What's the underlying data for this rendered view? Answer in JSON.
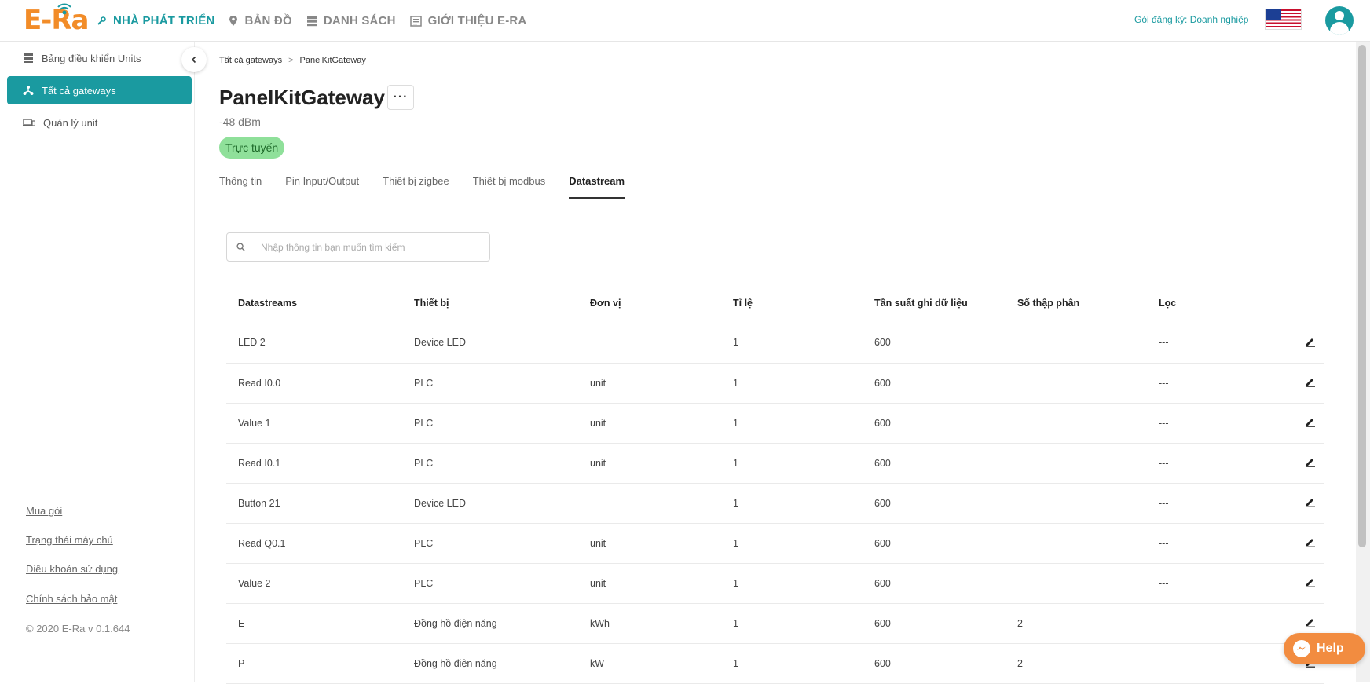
{
  "brand": {
    "logo_text": "E-Ra"
  },
  "nav": [
    {
      "label": "NHÀ PHÁT TRIỂN",
      "icon": "wrench-icon",
      "active": true
    },
    {
      "label": "BẢN ĐỒ",
      "icon": "map-pin-icon",
      "active": false
    },
    {
      "label": "DANH SÁCH",
      "icon": "list-icon",
      "active": false
    },
    {
      "label": "GIỚI THIỆU E-RA",
      "icon": "info-card-icon",
      "active": false
    }
  ],
  "header": {
    "plan_label": "Gói đăng ký: Doanh nghiệp"
  },
  "sidebar": {
    "items": [
      {
        "label": "Bảng điều khiển Units",
        "icon": "dashboard-icon"
      },
      {
        "label": "Tất cả gateways",
        "icon": "gateway-icon",
        "active": true
      },
      {
        "label": "Quản lý unit",
        "icon": "devices-icon"
      }
    ],
    "links": [
      "Mua gói",
      "Trạng thái máy chủ",
      "Điều khoản sử dụng",
      "Chính sách bảo mật"
    ],
    "copyright": "© 2020 E-Ra v 0.1.644"
  },
  "breadcrumb": {
    "parent": "Tất cả gateways",
    "sep": ">",
    "current": "PanelKitGateway"
  },
  "gateway": {
    "title": "PanelKitGateway",
    "more": "···",
    "signal": "-48 dBm",
    "status": "Trực tuyến"
  },
  "tabs": [
    "Thông tin",
    "Pin Input/Output",
    "Thiết bị zigbee",
    "Thiết bị modbus",
    "Datastream"
  ],
  "search": {
    "placeholder": "Nhập thông tin bạn muốn tìm kiếm",
    "value": ""
  },
  "table": {
    "columns": [
      "Datastreams",
      "Thiết bị",
      "Đơn vị",
      "Tỉ lệ",
      "Tần suất ghi dữ liệu",
      "Số thập phân",
      "Lọc"
    ],
    "rows": [
      [
        "LED 2",
        "Device LED",
        "",
        "1",
        "600",
        "",
        "---"
      ],
      [
        "Read I0.0",
        "PLC",
        "unit",
        "1",
        "600",
        "",
        "---"
      ],
      [
        "Value 1",
        "PLC",
        "unit",
        "1",
        "600",
        "",
        "---"
      ],
      [
        "Read I0.1",
        "PLC",
        "unit",
        "1",
        "600",
        "",
        "---"
      ],
      [
        "Button 21",
        "Device LED",
        "",
        "1",
        "600",
        "",
        "---"
      ],
      [
        "Read Q0.1",
        "PLC",
        "unit",
        "1",
        "600",
        "",
        "---"
      ],
      [
        "Value 2",
        "PLC",
        "unit",
        "1",
        "600",
        "",
        "---"
      ],
      [
        "E",
        "Đồng hồ điện năng",
        "kWh",
        "1",
        "600",
        "2",
        "---"
      ],
      [
        "P",
        "Đồng hồ điện năng",
        "kW",
        "1",
        "600",
        "2",
        "---"
      ]
    ]
  },
  "help": {
    "label": "Help"
  },
  "colors": {
    "accent": "#1a9aa0",
    "brand": "#f28c28",
    "status_bg": "#8fe09a"
  }
}
